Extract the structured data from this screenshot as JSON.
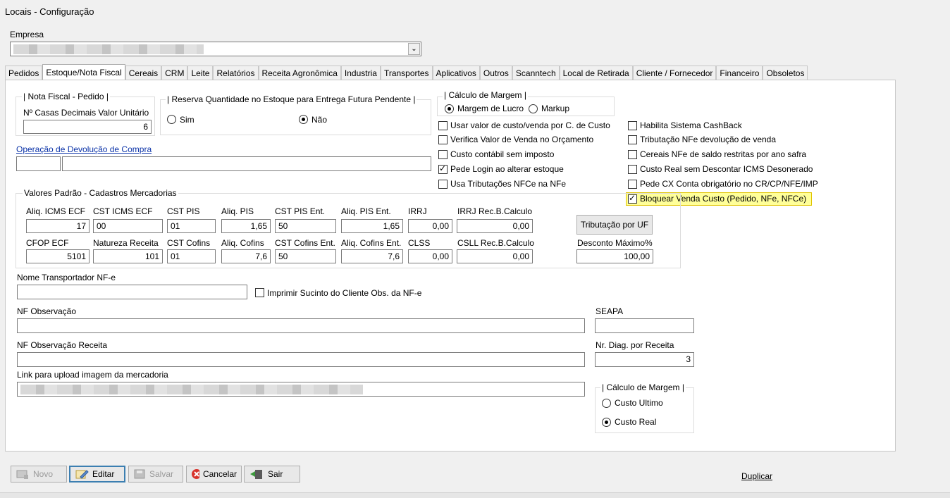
{
  "window": {
    "title": "Locais - Configuração"
  },
  "empresa": {
    "label": "Empresa"
  },
  "tabs": [
    "Pedidos",
    "Estoque/Nota Fiscal",
    "Cereais",
    "CRM",
    "Leite",
    "Relatórios",
    "Receita Agronômica",
    "Industria",
    "Transportes",
    "Aplicativos",
    "Outros",
    "Scanntech",
    "Local de Retirada",
    "Cliente / Fornecedor",
    "Financeiro",
    "Obsoletos"
  ],
  "active_tab": "Estoque/Nota Fiscal",
  "nf_pedido": {
    "title": "| Nota Fiscal - Pedido |",
    "casas_label": "Nº Casas Decimais Valor Unitário",
    "casas_value": "6"
  },
  "reserva": {
    "title": "| Reserva Quantidade no Estoque para Entrega Futura Pendente |",
    "sim": "Sim",
    "nao": "Não",
    "selected": "Não"
  },
  "margem_top": {
    "title": "| Cálculo de Margem |",
    "opt1": "Margem de Lucro",
    "opt2": "Markup",
    "selected": "Margem de Lucro"
  },
  "checks_left": [
    {
      "label": "Usar valor de custo/venda por C. de Custo",
      "checked": false
    },
    {
      "label": "Verifica Valor de Venda no Orçamento",
      "checked": false
    },
    {
      "label": "Custo contábil sem imposto",
      "checked": false
    },
    {
      "label": "Pede Login ao alterar estoque",
      "checked": true
    },
    {
      "label": "Usa Tributações NFCe na NFe",
      "checked": false
    }
  ],
  "checks_right": [
    {
      "label": "Habilita Sistema CashBack",
      "checked": false
    },
    {
      "label": "Tributação NFe devolução de venda",
      "checked": false
    },
    {
      "label": "Cereais NFe de saldo restritas por ano safra",
      "checked": false
    },
    {
      "label": "Custo Real sem Descontar ICMS Desonerado",
      "checked": false
    },
    {
      "label": "Pede CX Conta obrigatório no CR/CP/NFE/IMP",
      "checked": false
    },
    {
      "label": "Bloquear Venda Custo (Pedido, NFe, NFCe)",
      "checked": true
    }
  ],
  "devolucao": {
    "link": "Operação de Devolução de Compra"
  },
  "valores": {
    "title": "Valores Padrão - Cadastros Mercadorias",
    "row1": [
      {
        "label": "Aliq. ICMS ECF",
        "value": "17",
        "align": "r"
      },
      {
        "label": "CST ICMS ECF",
        "value": "00",
        "align": "l"
      },
      {
        "label": "CST PIS",
        "value": "01",
        "align": "l"
      },
      {
        "label": "Aliq. PIS",
        "value": "1,65",
        "align": "r"
      },
      {
        "label": "CST PIS Ent.",
        "value": "50",
        "align": "l"
      },
      {
        "label": "Aliq. PIS Ent.",
        "value": "1,65",
        "align": "r"
      },
      {
        "label": "IRRJ",
        "value": "0,00",
        "align": "r"
      },
      {
        "label": "IRRJ Rec.B.Calculo",
        "value": "0,00",
        "align": "r"
      }
    ],
    "row2": [
      {
        "label": "CFOP ECF",
        "value": "5101",
        "align": "r"
      },
      {
        "label": "Natureza Receita",
        "value": "101",
        "align": "r"
      },
      {
        "label": "CST Cofins",
        "value": "01",
        "align": "l"
      },
      {
        "label": "Aliq. Cofins",
        "value": "7,6",
        "align": "r"
      },
      {
        "label": "CST Cofins Ent.",
        "value": "50",
        "align": "l"
      },
      {
        "label": "Aliq. Cofins Ent.",
        "value": "7,6",
        "align": "r"
      },
      {
        "label": "CLSS",
        "value": "0,00",
        "align": "r"
      },
      {
        "label": "CSLL Rec.B.Calculo",
        "value": "0,00",
        "align": "r"
      }
    ],
    "trib_uf_button": "Tributação por UF",
    "desconto_label": "Desconto Máximo%",
    "desconto_value": "100,00"
  },
  "transportador": {
    "label": "Nome Transportador NF-e",
    "value": "",
    "imprimir_label": "Imprimir Sucinto do Cliente Obs. da NF-e",
    "imprimir_checked": false
  },
  "nf_obs": {
    "label": "NF Observação",
    "value": ""
  },
  "seapa": {
    "label": "SEAPA",
    "value": ""
  },
  "nf_obs_receita": {
    "label": "NF Observação Receita",
    "value": ""
  },
  "nr_diag": {
    "label": "Nr. Diag. por Receita",
    "value": "3"
  },
  "link_upload": {
    "label": "Link para upload imagem da mercadoria"
  },
  "margem_bottom": {
    "title": "| Cálculo de Margem |",
    "opt1": "Custo Ultimo",
    "opt2": "Custo Real",
    "selected": "Custo Real"
  },
  "toolbar": {
    "novo": "Novo",
    "editar": "Editar",
    "salvar": "Salvar",
    "cancelar": "Cancelar",
    "sair": "Sair"
  },
  "duplicar": "Duplicar",
  "colors": {
    "highlight": "#ffff99",
    "link": "#0b33a8",
    "cancel_red": "#d7322b"
  }
}
